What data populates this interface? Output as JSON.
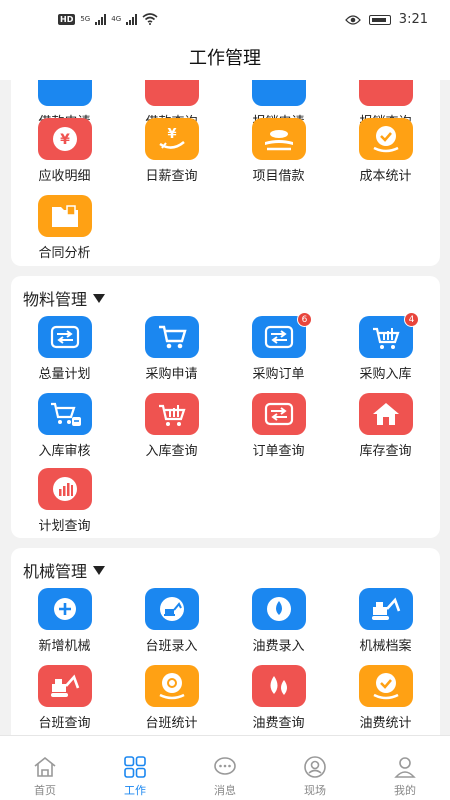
{
  "status_bar": {
    "network_1": "5G",
    "network_2": "4G",
    "time": "3:21",
    "hd": "HD"
  },
  "header": {
    "title": "工作管理"
  },
  "colors": {
    "blue": "#1b87f0",
    "red": "#ef5350",
    "orange": "#ffa114"
  },
  "finance": {
    "top_row": [
      {
        "label": "借款申请",
        "icon": "loan-apply-icon"
      },
      {
        "label": "借款查询",
        "icon": "loan-query-icon"
      },
      {
        "label": "报销申请",
        "icon": "reimburse-apply-icon"
      },
      {
        "label": "报销查询",
        "icon": "reimburse-query-icon"
      }
    ],
    "items": [
      {
        "label": "应收明细",
        "icon": "yen-icon"
      },
      {
        "label": "日薪查询",
        "icon": "daily-wage-icon"
      },
      {
        "label": "项目借款",
        "icon": "project-loan-icon"
      },
      {
        "label": "成本统计",
        "icon": "cost-stat-icon"
      },
      {
        "label": "合同分析",
        "icon": "folder-icon"
      }
    ]
  },
  "materials": {
    "title": "物料管理",
    "items": [
      {
        "label": "总量计划",
        "icon": "transfer-icon"
      },
      {
        "label": "采购申请",
        "icon": "cart-icon"
      },
      {
        "label": "采购订单",
        "icon": "transfer-icon",
        "badge": "6"
      },
      {
        "label": "采购入库",
        "icon": "cart-chart-icon",
        "badge": "4"
      },
      {
        "label": "入库审核",
        "icon": "cart-check-icon"
      },
      {
        "label": "入库查询",
        "icon": "cart-chart-icon"
      },
      {
        "label": "订单查询",
        "icon": "transfer-icon"
      },
      {
        "label": "库存查询",
        "icon": "home-icon"
      },
      {
        "label": "计划查询",
        "icon": "bar-chart-icon"
      }
    ]
  },
  "machinery": {
    "title": "机械管理",
    "items": [
      {
        "label": "新增机械",
        "icon": "plus-icon"
      },
      {
        "label": "台班录入",
        "icon": "excavator-icon"
      },
      {
        "label": "油费录入",
        "icon": "drop-icon"
      },
      {
        "label": "机械档案",
        "icon": "excavator-icon"
      },
      {
        "label": "台班查询",
        "icon": "excavator-icon"
      },
      {
        "label": "台班统计",
        "icon": "chat-stat-icon"
      },
      {
        "label": "油费查询",
        "icon": "drops-icon"
      },
      {
        "label": "油费统计",
        "icon": "cost-stat-icon"
      }
    ]
  },
  "tabbar": {
    "items": [
      {
        "label": "首页",
        "icon": "home-outline-icon",
        "active": false
      },
      {
        "label": "工作",
        "icon": "grid-icon",
        "active": true
      },
      {
        "label": "消息",
        "icon": "message-icon",
        "active": false
      },
      {
        "label": "现场",
        "icon": "site-icon",
        "active": false
      },
      {
        "label": "我的",
        "icon": "user-icon",
        "active": false
      }
    ]
  }
}
